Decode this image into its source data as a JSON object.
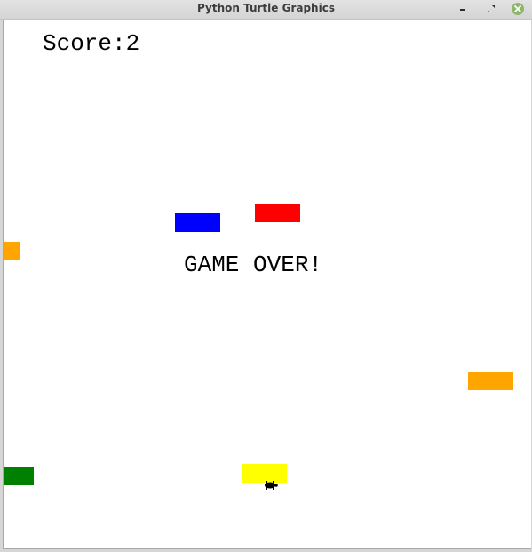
{
  "window": {
    "title": "Python Turtle Graphics",
    "controls": [
      "minimize-icon",
      "maximize-icon",
      "close-icon"
    ]
  },
  "game": {
    "score_label": "Score:2",
    "status_text": "GAME OVER!",
    "background_color": "#ffffff",
    "blocks": [
      {
        "name": "blue-block",
        "color": "#0000ff"
      },
      {
        "name": "red-block",
        "color": "#ff0000"
      },
      {
        "name": "orange-block-left",
        "color": "#ffa500"
      },
      {
        "name": "orange-block-right",
        "color": "#ffa500"
      },
      {
        "name": "green-block",
        "color": "#008000"
      },
      {
        "name": "yellow-block",
        "color": "#ffff00"
      }
    ],
    "player": {
      "icon": "turtle-icon",
      "color": "#000000"
    }
  }
}
